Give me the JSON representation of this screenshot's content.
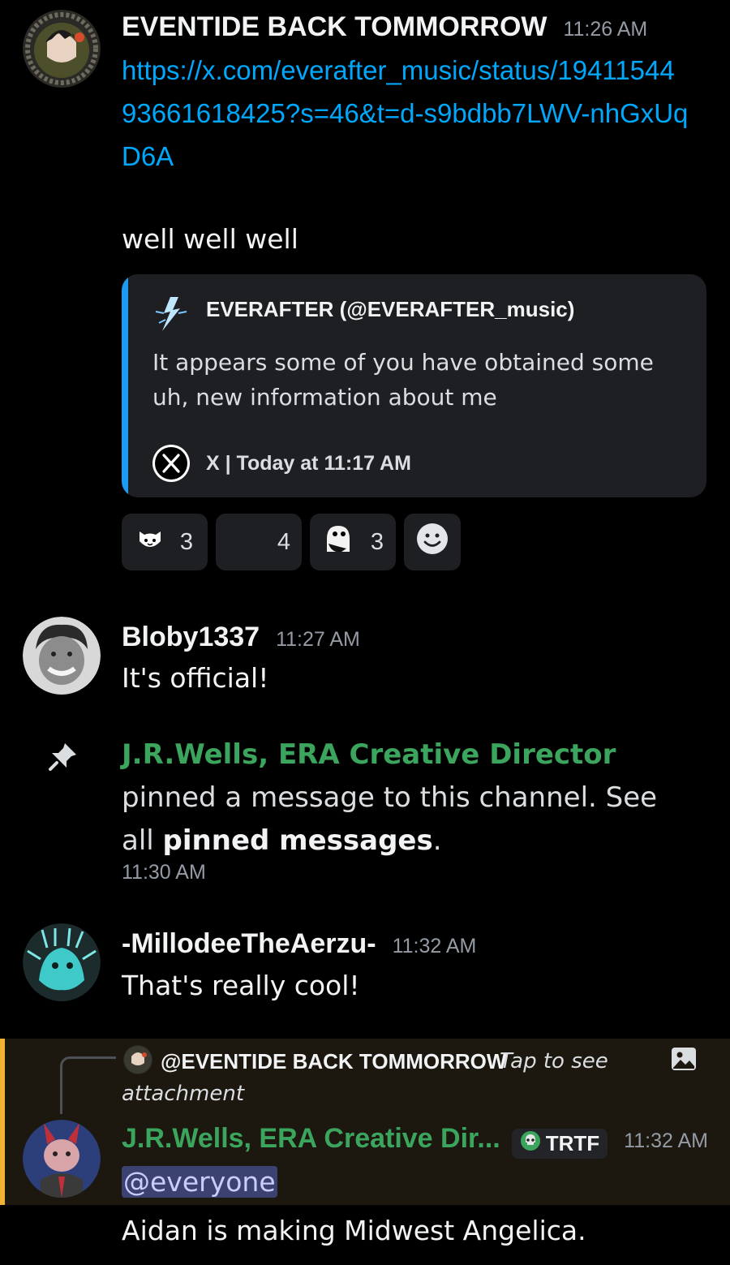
{
  "message1": {
    "username": "EVENTIDE BACK TOMMORROW",
    "time": "11:26 AM",
    "link": "https://x.com/everafter_music/status/1941154493661618425?s=46&t=d-s9bdbb7LWV-nhGxUqD6A",
    "text": "well well well",
    "embed": {
      "author": "EVERAFTER (@EVERAFTER_music)",
      "description": "It appears some of you have obtained some uh, new information about me",
      "footer": "X | Today at 11:17 AM"
    },
    "reactions": [
      {
        "icon": "cat-face-emoji-icon",
        "count": "3"
      },
      {
        "icon": "blank-emoji-icon",
        "count": "4"
      },
      {
        "icon": "ghost-emoji-icon",
        "count": "3"
      }
    ],
    "add_reaction_icon": "smiley-add-reaction-icon"
  },
  "message2": {
    "username": "Bloby1337",
    "time": "11:27 AM",
    "text": "It's official!"
  },
  "pin_notice": {
    "actor": "J.R.Wells, ERA Creative Director",
    "text_before": "pinned a message to this channel. See all",
    "link_text": "pinned messages",
    "text_after": ".",
    "time": "11:30 AM"
  },
  "message3": {
    "username": "-MillodeeTheAerzu-",
    "time": "11:32 AM",
    "text": "That's really cool!"
  },
  "message4": {
    "reply_author": "@EVENTIDE BACK TOMMORROW",
    "reply_text": "Tap to see attachment",
    "username": "J.R.Wells, ERA Creative Dir...",
    "tag": "TRTF",
    "time": "11:32 AM",
    "mention": "@everyone",
    "text": "Aidan is making Midwest Angelica."
  },
  "colors": {
    "background": "#000000",
    "link": "#00a8fc",
    "role_green": "#3ba55d",
    "embed_bar": "#1d9bf0",
    "highlight_bar": "#f0b232"
  }
}
